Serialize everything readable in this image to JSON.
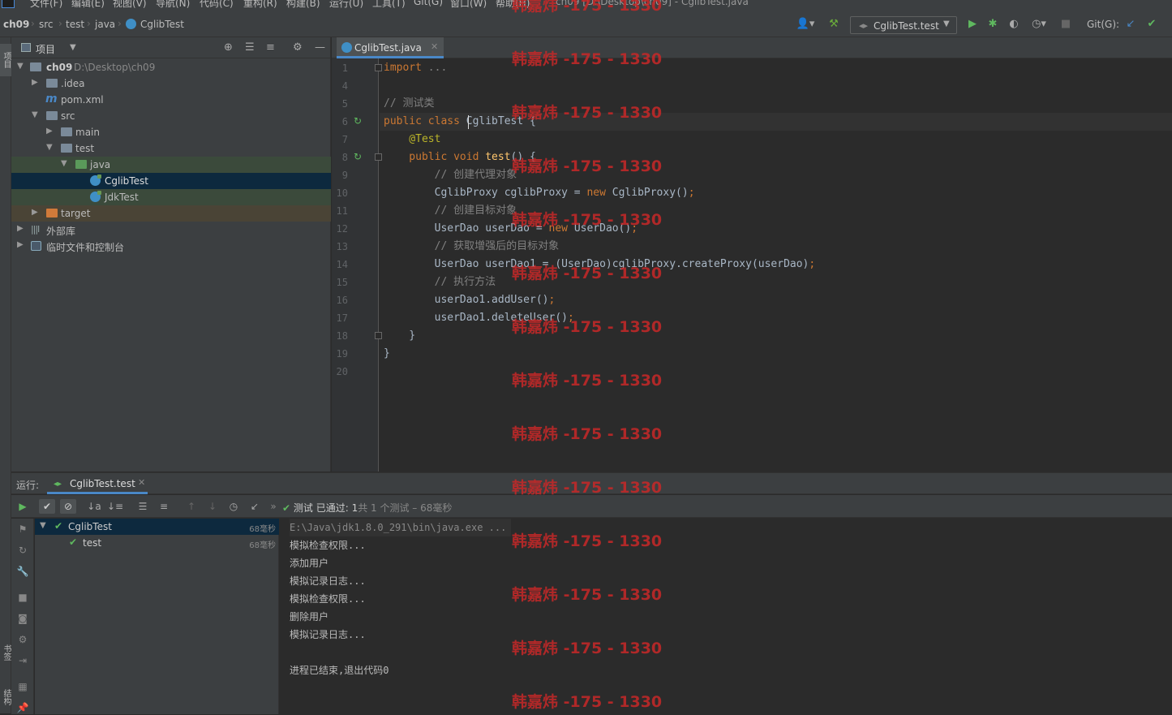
{
  "menubar": {
    "items": [
      "文件(F)",
      "编辑(E)",
      "视图(V)",
      "导航(N)",
      "代码(C)",
      "重构(R)",
      "构建(B)",
      "运行(U)",
      "工具(T)",
      "Git(G)",
      "窗口(W)",
      "帮助(H)"
    ],
    "window_title": "ch09 [D:\\Desktop\\ch09] - CglibTest.java"
  },
  "breadcrumb": [
    "ch09",
    "src",
    "test",
    "java",
    "CglibTest"
  ],
  "toolbar": {
    "run_config": "CglibTest.test",
    "git_label": "Git(G):"
  },
  "leftstrip": {
    "project_label": "项目",
    "bookmarks_label": "书签",
    "structure_label": "结构"
  },
  "project": {
    "title": "项目",
    "tree": [
      {
        "label": "ch09",
        "hint": "D:\\Desktop\\ch09"
      },
      {
        "label": ".idea"
      },
      {
        "label": "pom.xml"
      },
      {
        "label": "src"
      },
      {
        "label": "main"
      },
      {
        "label": "test"
      },
      {
        "label": "java"
      },
      {
        "label": "CglibTest"
      },
      {
        "label": "JdkTest"
      },
      {
        "label": "target"
      },
      {
        "label": "外部库"
      },
      {
        "label": "临时文件和控制台"
      }
    ]
  },
  "editor": {
    "tab": "CglibTest.java",
    "lines": [
      {
        "n": "1",
        "parts": [
          {
            "c": "kw",
            "t": "import"
          },
          {
            "c": "",
            "t": " "
          },
          {
            "c": "cm",
            "t": "..."
          }
        ]
      },
      {
        "n": "4",
        "parts": []
      },
      {
        "n": "5",
        "parts": [
          {
            "c": "cm",
            "t": "// 测试类"
          }
        ]
      },
      {
        "n": "6",
        "parts": [
          {
            "c": "kw",
            "t": "public class "
          },
          {
            "c": "",
            "t": "CglibTest {"
          }
        ]
      },
      {
        "n": "7",
        "parts": [
          {
            "c": "ann",
            "t": "    @Test"
          }
        ]
      },
      {
        "n": "8",
        "parts": [
          {
            "c": "kw",
            "t": "    public void "
          },
          {
            "c": "fn",
            "t": "test"
          },
          {
            "c": "",
            "t": "() {"
          }
        ]
      },
      {
        "n": "9",
        "parts": [
          {
            "c": "cm",
            "t": "        // 创建代理对象"
          }
        ]
      },
      {
        "n": "10",
        "parts": [
          {
            "c": "",
            "t": "        CglibProxy cglibProxy = "
          },
          {
            "c": "kw",
            "t": "new "
          },
          {
            "c": "",
            "t": "CglibProxy()"
          },
          {
            "c": "kw",
            "t": ";"
          }
        ]
      },
      {
        "n": "11",
        "parts": [
          {
            "c": "cm",
            "t": "        // 创建目标对象"
          }
        ]
      },
      {
        "n": "12",
        "parts": [
          {
            "c": "",
            "t": "        UserDao userDao = "
          },
          {
            "c": "kw",
            "t": "new "
          },
          {
            "c": "",
            "t": "UserDao()"
          },
          {
            "c": "kw",
            "t": ";"
          }
        ]
      },
      {
        "n": "13",
        "parts": [
          {
            "c": "cm",
            "t": "        // 获取增强后的目标对象"
          }
        ]
      },
      {
        "n": "14",
        "parts": [
          {
            "c": "",
            "t": "        UserDao userDao1 = (UserDao)cglibProxy.createProxy(userDao)"
          },
          {
            "c": "kw",
            "t": ";"
          }
        ]
      },
      {
        "n": "15",
        "parts": [
          {
            "c": "cm",
            "t": "        // 执行方法"
          }
        ]
      },
      {
        "n": "16",
        "parts": [
          {
            "c": "",
            "t": "        userDao1.addUser()"
          },
          {
            "c": "kw",
            "t": ";"
          }
        ]
      },
      {
        "n": "17",
        "parts": [
          {
            "c": "",
            "t": "        userDao1.deleteUser()"
          },
          {
            "c": "kw",
            "t": ";"
          }
        ]
      },
      {
        "n": "18",
        "parts": [
          {
            "c": "",
            "t": "    }"
          }
        ]
      },
      {
        "n": "19",
        "parts": [
          {
            "c": "",
            "t": "}"
          }
        ]
      },
      {
        "n": "20",
        "parts": []
      }
    ]
  },
  "run": {
    "label": "运行:",
    "tab": "CglibTest.test",
    "status_prefix": "测试 已通过: ",
    "status_count": "1",
    "status_suffix": "共 1 个测试 – 68毫秒",
    "tests": [
      {
        "name": "CglibTest",
        "time": "68毫秒"
      },
      {
        "name": "test",
        "time": "68毫秒"
      }
    ],
    "console": [
      "E:\\Java\\jdk1.8.0_291\\bin\\java.exe ...",
      "模拟检查权限...",
      "添加用户",
      "模拟记录日志...",
      "模拟检查权限...",
      "删除用户",
      "模拟记录日志...",
      "",
      "进程已结束,退出代码0"
    ]
  },
  "watermark": "韩嘉炜 -175 - 1330",
  "colors": {
    "accent": "#4a88c7",
    "pass": "#5fb85f",
    "keyword": "#cc7832",
    "annotation": "#bbb529",
    "watermark": "#c82828"
  }
}
